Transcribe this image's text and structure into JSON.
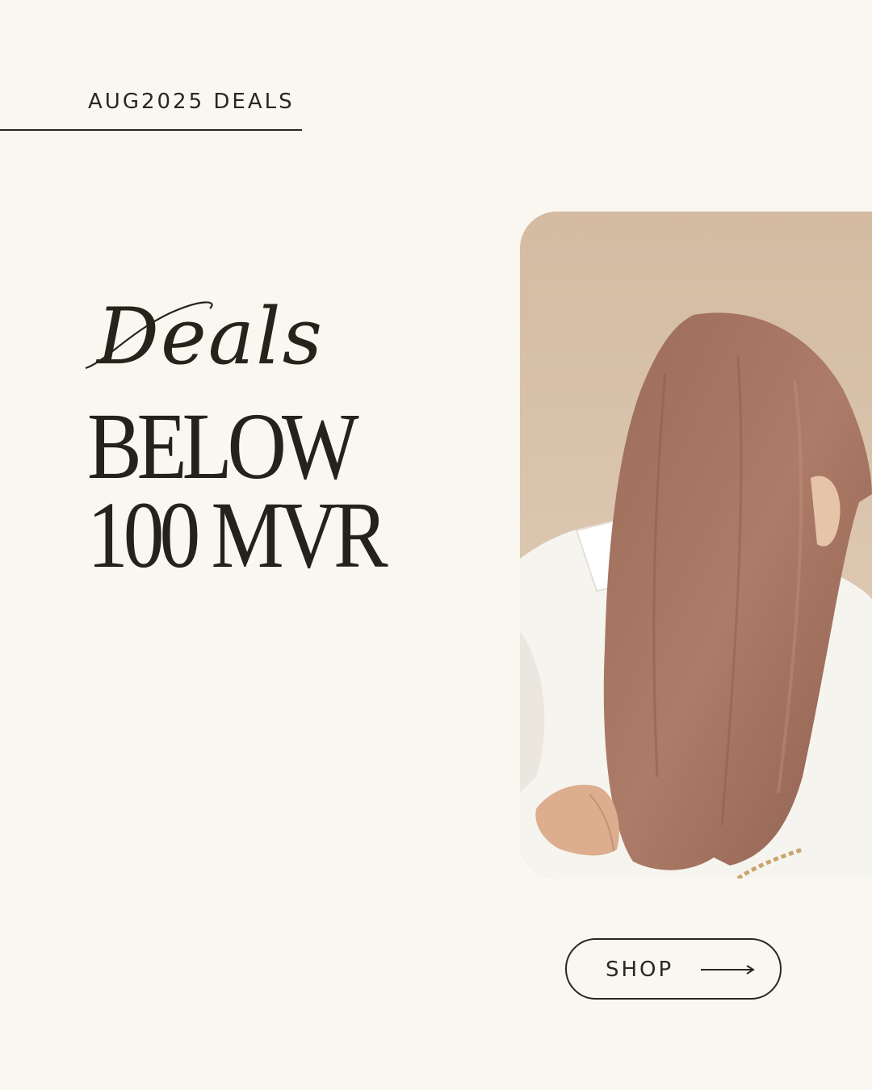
{
  "promo": {
    "eyebrow": "AUG2025 DEALS",
    "script_word": "Deals",
    "headline_line1": "BELOW",
    "headline_line2": "100 MVR"
  },
  "cta": {
    "label": "SHOP",
    "icon": "arrow-right-icon"
  },
  "colors": {
    "background": "#faf7f0",
    "ink": "#24221a",
    "photo_backdrop": "#d7bfa6",
    "scarf": "#a97865",
    "shirt": "#f7f6f2"
  }
}
